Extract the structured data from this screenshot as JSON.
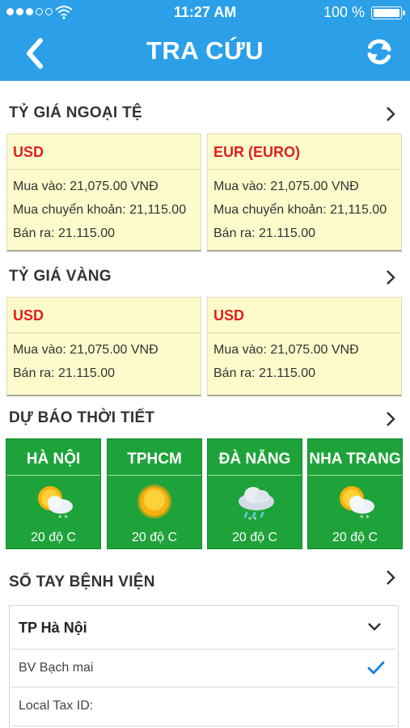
{
  "status_bar": {
    "time": "11:27 AM",
    "battery": "100 %"
  },
  "nav": {
    "title": "TRA CỨU",
    "back_icon": "chevron-left-icon",
    "refresh_icon": "refresh-icon"
  },
  "exchange": {
    "title": "TỶ GIÁ NGOẠI TỆ",
    "cards": [
      {
        "currency": "USD",
        "buy": "Mua vào: 21,075.00 VNĐ",
        "transfer": "Mua chuyển khoản: 21,115.00",
        "sell": "Bán ra: 21.115.00"
      },
      {
        "currency": "EUR (EURO)",
        "buy": "Mua vào: 21,075.00 VNĐ",
        "transfer": "Mua chuyển khoản: 21,115.00",
        "sell": "Bán ra: 21.115.00"
      }
    ]
  },
  "gold": {
    "title": "TỶ GIÁ VÀNG",
    "cards": [
      {
        "currency": "USD",
        "buy": "Mua vào: 21,075.00 VNĐ",
        "sell": "Bán ra: 21.115.00"
      },
      {
        "currency": "USD",
        "buy": "Mua vào: 21,075.00 VNĐ",
        "sell": "Bán ra: 21.115.00"
      }
    ]
  },
  "weather": {
    "title": "DỰ BÁO THỜI TIẾT",
    "cities": [
      {
        "name": "HÀ NỘI",
        "temp": "20 độ C",
        "icon": "partly-cloudy-snow-icon"
      },
      {
        "name": "TPHCM",
        "temp": "20 độ C",
        "icon": "sunny-icon"
      },
      {
        "name": "ĐÀ NẴNG",
        "temp": "20 độ C",
        "icon": "cloud-rain-snow-icon"
      },
      {
        "name": "NHA TRANG",
        "temp": "20 độ C",
        "icon": "partly-cloudy-snow-icon"
      }
    ]
  },
  "hospital": {
    "title": "SỔ TAY BỆNH VIỆN",
    "city": "TP Hà Nội",
    "options": [
      "BV Bạch mai",
      "Local Tax ID:"
    ],
    "selected": "BV Bạch mai"
  },
  "colors": {
    "nav_blue": "#2ba0e8",
    "card_yellow": "#fdfbcb",
    "currency_red": "#e02020",
    "weather_green": "#1ea33a",
    "check_blue": "#1a7fe0"
  }
}
